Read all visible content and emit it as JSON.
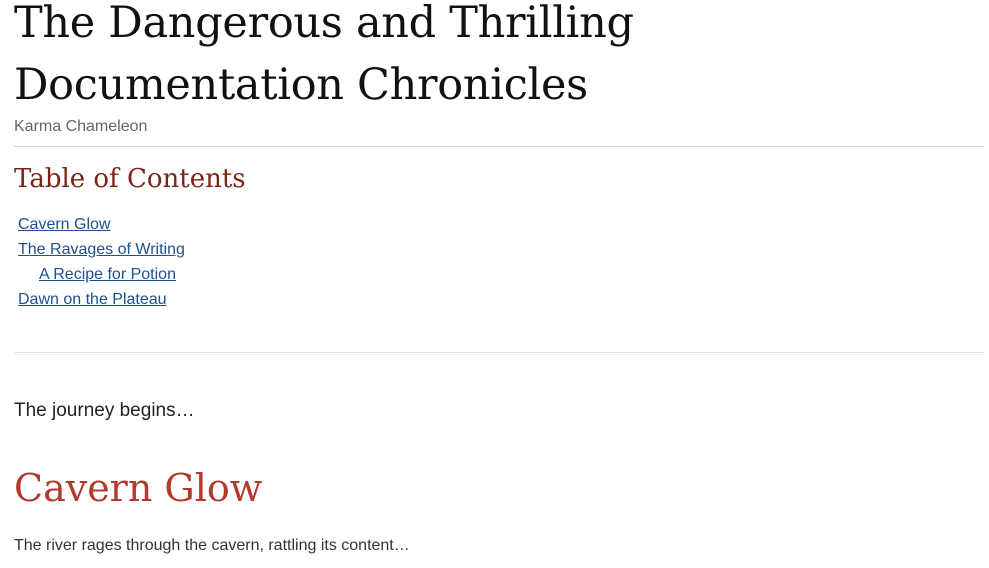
{
  "document": {
    "title": "The Dangerous and Thrilling Documentation Chronicles",
    "author": "Karma Chameleon"
  },
  "toc": {
    "heading": "Table of Contents",
    "items": [
      {
        "label": "Cavern Glow",
        "level": 1
      },
      {
        "label": "The Ravages of Writing",
        "level": 1
      },
      {
        "label": "A Recipe for Potion",
        "level": 2
      },
      {
        "label": "Dawn on the Plateau",
        "level": 1
      }
    ]
  },
  "intro": "The journey begins…",
  "sections": [
    {
      "heading": "Cavern Glow",
      "text": "The river rages through the cavern, rattling its content…"
    }
  ]
}
